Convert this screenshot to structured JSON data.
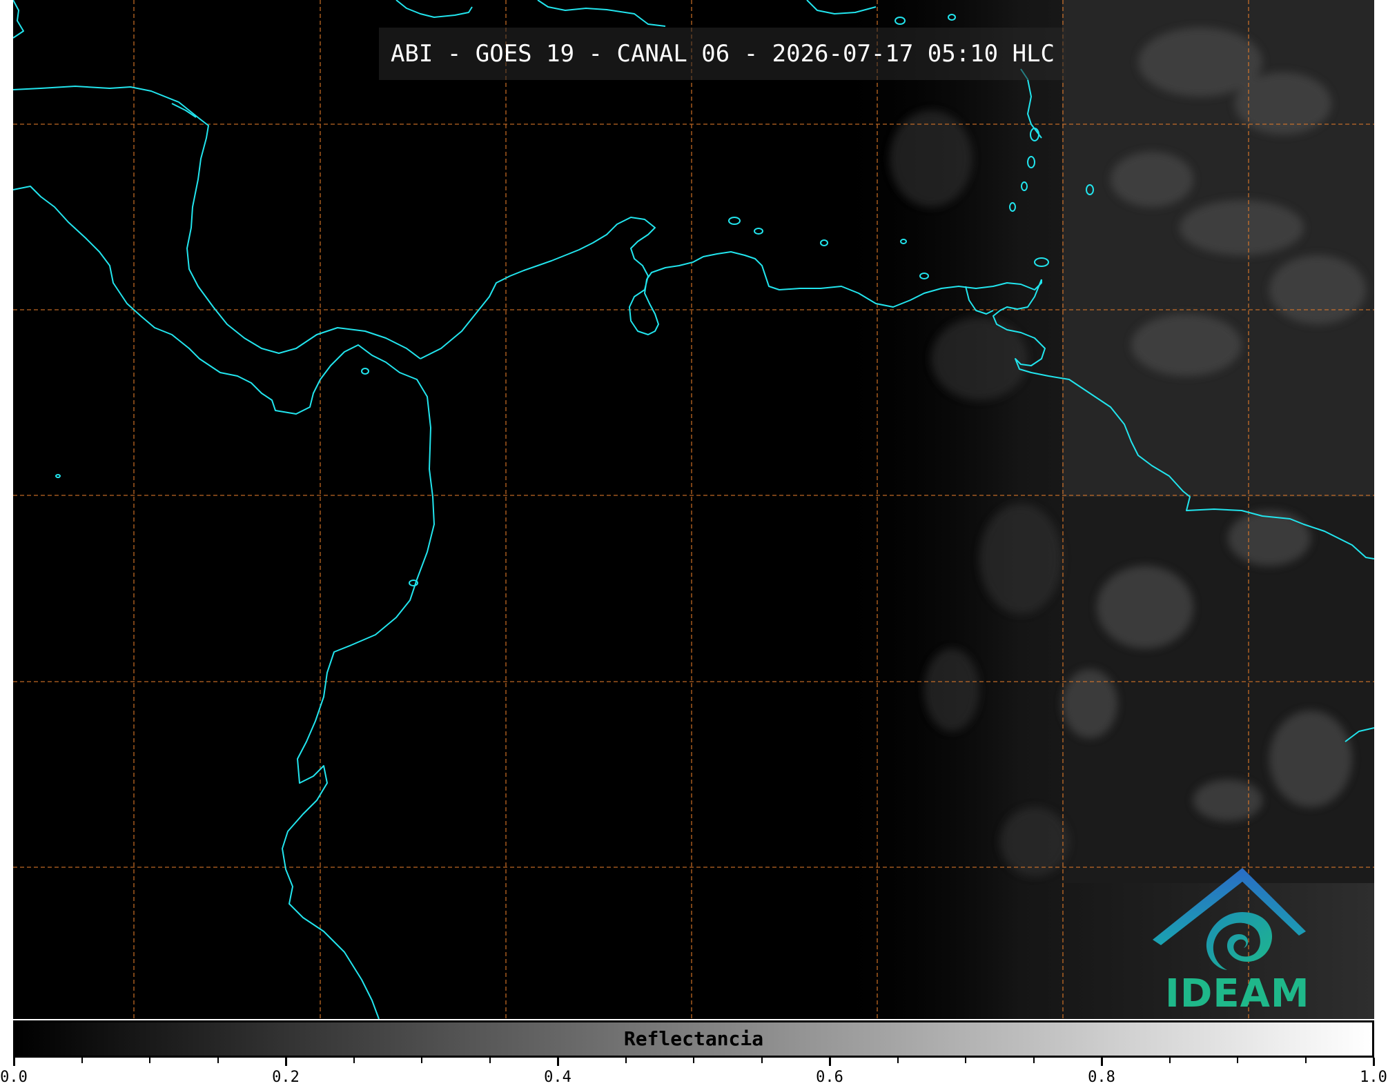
{
  "title": "ABI - GOES 19 - CANAL 06 - 2026-07-17 05:10 HLC",
  "logo": {
    "text": "IDEAM",
    "icon": "ideam-spiral-logo"
  },
  "colorbar": {
    "label": "Reflectancia",
    "min": 0.0,
    "max": 1.0,
    "tick_labels": [
      "0.0",
      "0.2",
      "0.4",
      "0.6",
      "0.8",
      "1.0"
    ],
    "colormap": [
      "#000000",
      "#ffffff"
    ]
  },
  "map": {
    "coastline_color": "#22e5ee",
    "gridline_color": "#e07a2a",
    "background_color": "#000000"
  }
}
